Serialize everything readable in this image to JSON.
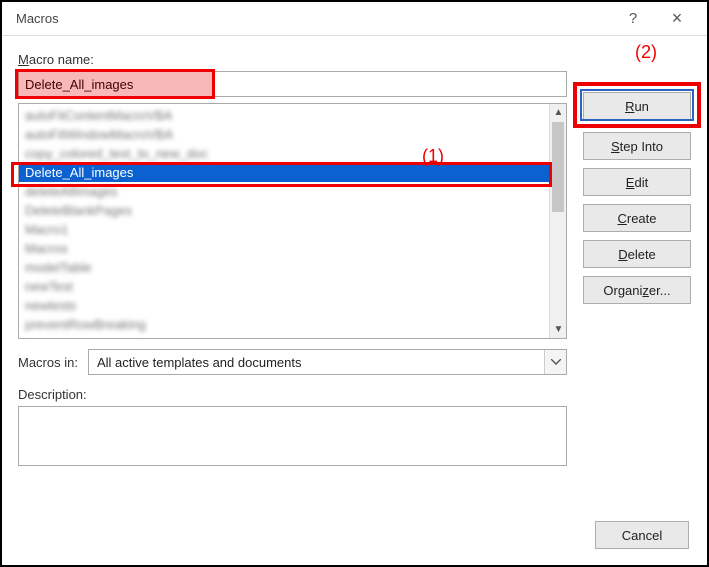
{
  "window": {
    "title": "Macros",
    "help": "?",
    "close": "×"
  },
  "labels": {
    "macro_name_prefix": "M",
    "macro_name_rest": "acro name:",
    "macros_in": "Macros in:",
    "macros_in_ul": "i",
    "description": "Description:"
  },
  "name_value": "Delete_All_images",
  "macros_in_value": "All active templates and documents",
  "list": {
    "items": [
      {
        "label": "autoFitContentMacroVBA",
        "blurred": true
      },
      {
        "label": "autoFitWindowMacroVBA",
        "blurred": true
      },
      {
        "label": "copy_colored_text_to_new_doc",
        "blurred": true
      },
      {
        "label": "Delete_All_images",
        "selected": true
      },
      {
        "label": "deleteAllImages",
        "blurred": true
      },
      {
        "label": "DeleteBlankPages",
        "blurred": true
      },
      {
        "label": "Macro1",
        "blurred": true
      },
      {
        "label": "Macros",
        "blurred": true
      },
      {
        "label": "modelTable",
        "blurred": true
      },
      {
        "label": "newTest",
        "blurred": true
      },
      {
        "label": "newtests",
        "blurred": true
      },
      {
        "label": "preventRowBreaking",
        "blurred": true
      }
    ]
  },
  "buttons": {
    "run_ul": "R",
    "run_rest": "un",
    "step_ul": "S",
    "step_rest": "tep Into",
    "edit_ul": "E",
    "edit_rest": "dit",
    "create_ul": "C",
    "create_rest": "reate",
    "delete_ul": "D",
    "delete_rest": "elete",
    "organizer": "Organizer...",
    "cancel": "Cancel"
  },
  "annotations": {
    "one": "(1)",
    "two": "(2)"
  }
}
